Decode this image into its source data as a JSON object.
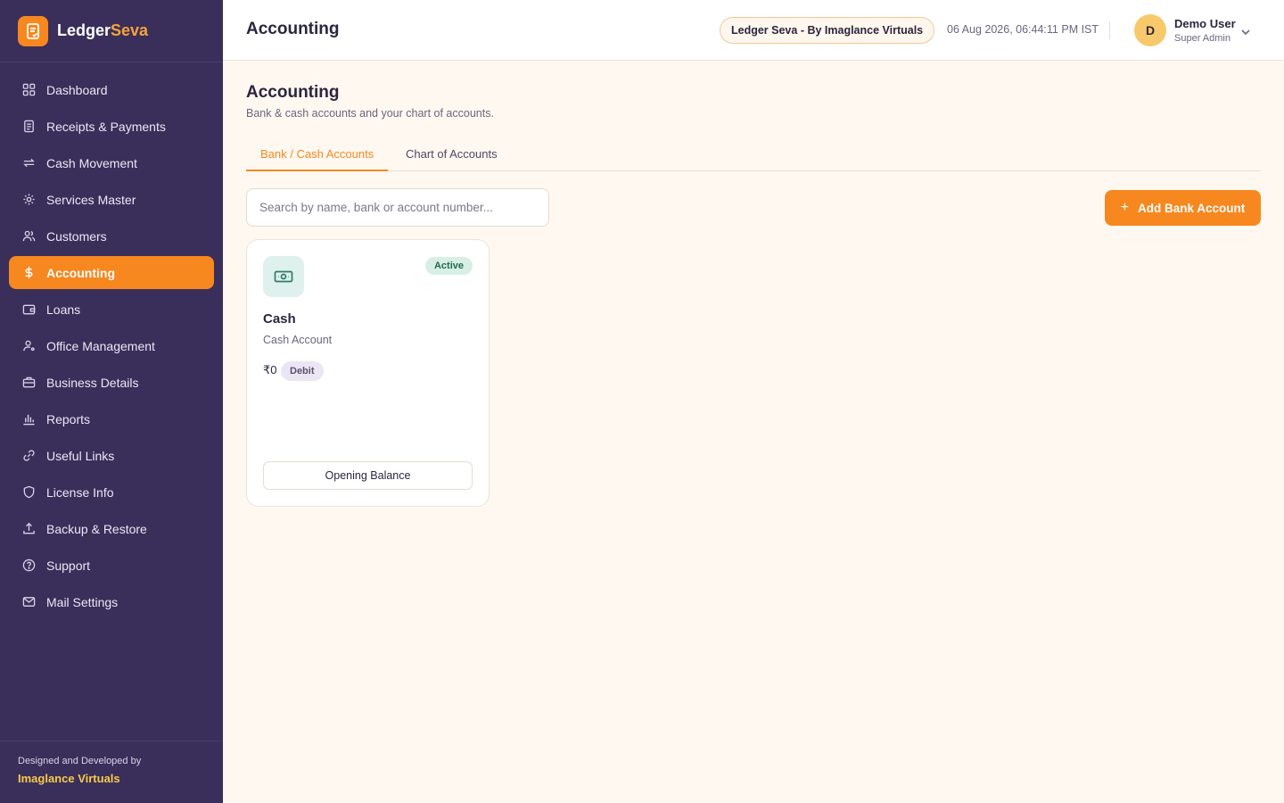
{
  "brand": {
    "name_part1": "Ledger",
    "name_part2": "Seva",
    "logo_icon": "ledger-book-icon"
  },
  "sidebar": {
    "items": [
      {
        "label": "Dashboard",
        "icon": "grid-icon",
        "active": false
      },
      {
        "label": "Receipts & Payments",
        "icon": "receipt-icon",
        "active": false
      },
      {
        "label": "Cash Movement",
        "icon": "repeat-arrows-icon",
        "active": false
      },
      {
        "label": "Services Master",
        "icon": "gear-icon",
        "active": false
      },
      {
        "label": "Customers",
        "icon": "users-icon",
        "active": false
      },
      {
        "label": "Accounting",
        "icon": "dollar-icon",
        "active": true
      },
      {
        "label": "Loans",
        "icon": "wallet-icon",
        "active": false
      },
      {
        "label": "Office Management",
        "icon": "user-gear-icon",
        "active": false
      },
      {
        "label": "Business Details",
        "icon": "briefcase-icon",
        "active": false
      },
      {
        "label": "Reports",
        "icon": "bar-chart-icon",
        "active": false
      },
      {
        "label": "Useful Links",
        "icon": "link-icon",
        "active": false
      },
      {
        "label": "License Info",
        "icon": "shield-icon",
        "active": false
      },
      {
        "label": "Backup & Restore",
        "icon": "upload-icon",
        "active": false
      },
      {
        "label": "Support",
        "icon": "help-circle-icon",
        "active": false
      },
      {
        "label": "Mail Settings",
        "icon": "mail-icon",
        "active": false
      }
    ],
    "footer": {
      "caption": "Designed and Developed by",
      "company": "Imaglance Virtuals"
    }
  },
  "header": {
    "title": "Accounting",
    "org_pill": "Ledger Seva - By Imaglance Virtuals",
    "datetime": "06 Aug 2026, 06:44:11 PM IST",
    "user": {
      "initial": "D",
      "name": "Demo User",
      "role": "Super Admin"
    }
  },
  "main": {
    "title": "Accounting",
    "subtitle": "Bank & cash accounts and your chart of accounts.",
    "tabs": [
      {
        "label": "Bank / Cash Accounts",
        "active": true
      },
      {
        "label": "Chart of Accounts",
        "active": false
      }
    ],
    "search": {
      "placeholder": "Search by name, bank or account number...",
      "value": ""
    },
    "add_button": "Add Bank Account",
    "accounts": [
      {
        "name": "Cash",
        "type": "Cash Account",
        "status": "Active",
        "balance": "₹0",
        "balance_type": "Debit",
        "action": "Opening Balance",
        "icon": "banknote-icon"
      }
    ]
  },
  "colors": {
    "sidebar_bg": "#3a2f5b",
    "accent": "#f7871f",
    "page_bg": "#fff8f1",
    "active_badge_bg": "#d8efe6",
    "active_badge_text": "#1e6b4f",
    "footer_company": "#f7c948"
  }
}
